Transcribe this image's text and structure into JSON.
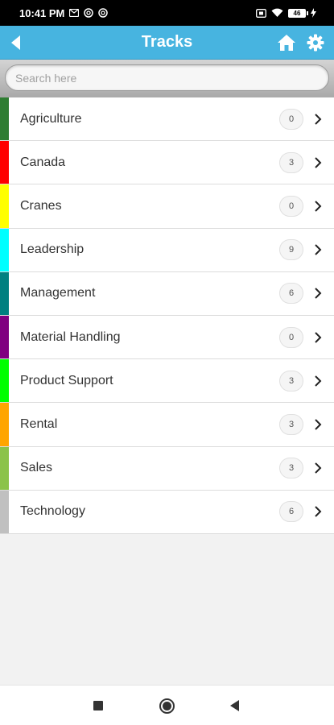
{
  "status_bar": {
    "time": "10:41 PM",
    "left_icons": [
      "message-icon",
      "at-sign-icon",
      "at-sign-icon"
    ],
    "right_icons": [
      "screenshot-icon",
      "wifi-icon",
      "battery-icon",
      "charging-icon"
    ],
    "battery_level": "46"
  },
  "header": {
    "title": "Tracks",
    "background_color": "#47b4e0",
    "icons": [
      "back-arrow-icon",
      "home-icon",
      "gear-icon"
    ]
  },
  "search": {
    "placeholder": "Search here",
    "value": ""
  },
  "tracks": [
    {
      "label": "Agriculture",
      "count": "0",
      "color": "#2e7d32"
    },
    {
      "label": "Canada",
      "count": "3",
      "color": "#ff0000"
    },
    {
      "label": "Cranes",
      "count": "0",
      "color": "#ffff00"
    },
    {
      "label": "Leadership",
      "count": "9",
      "color": "#00ffff"
    },
    {
      "label": "Management",
      "count": "6",
      "color": "#008080"
    },
    {
      "label": "Material Handling",
      "count": "0",
      "color": "#800080"
    },
    {
      "label": "Product Support",
      "count": "3",
      "color": "#00ff00"
    },
    {
      "label": "Rental",
      "count": "3",
      "color": "#ffa500"
    },
    {
      "label": "Sales",
      "count": "3",
      "color": "#8bc34a"
    },
    {
      "label": "Technology",
      "count": "6",
      "color": "#c0c0c0"
    }
  ],
  "nav_bar": {
    "icons": [
      "recent-apps-icon",
      "home-circle-icon",
      "back-triangle-icon"
    ]
  }
}
